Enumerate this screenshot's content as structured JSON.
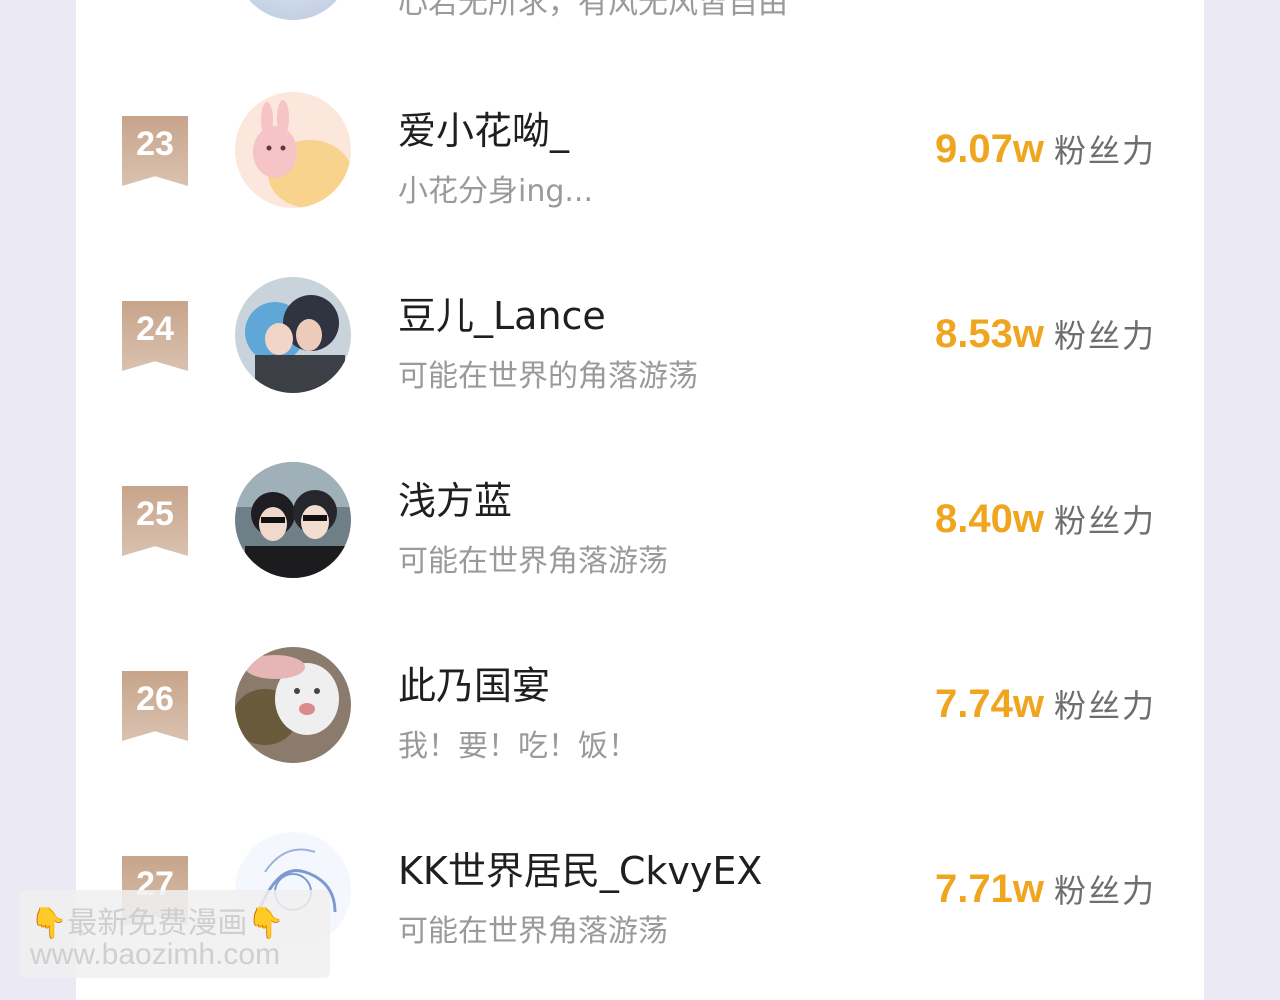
{
  "ranking": {
    "partial_top_row": {
      "signature": "心若无所求，有风无风皆自由"
    },
    "fans_label": "粉丝力",
    "entries": [
      {
        "rank": "23",
        "name": "爱小花呦_",
        "signature": "小花分身ing...",
        "fans": "9.07w"
      },
      {
        "rank": "24",
        "name": "豆儿_Lance",
        "signature": "可能在世界的角落游荡",
        "fans": "8.53w"
      },
      {
        "rank": "25",
        "name": "浅方蓝",
        "signature": "可能在世界角落游荡",
        "fans": "8.40w"
      },
      {
        "rank": "26",
        "name": "此乃国宴",
        "signature": "我！要！吃！饭！",
        "fans": "7.74w"
      },
      {
        "rank": "27",
        "name": "KK世界居民_CkvyEX",
        "signature": "可能在世界角落游荡",
        "fans": "7.71w"
      }
    ]
  },
  "watermark": {
    "line1": "👇最新免费漫画👇",
    "line2": "www.baozimh.com"
  },
  "colors": {
    "fans_accent": "#f0a51f",
    "rank_badge": "#c7a48a",
    "background": "#ebe9f4"
  }
}
